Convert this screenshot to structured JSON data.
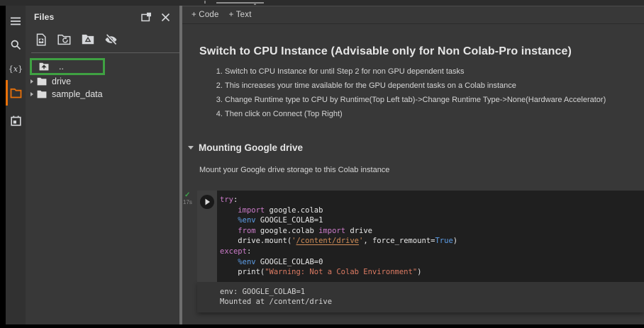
{
  "colors": {
    "accent_orange": "#e8710a",
    "highlight_green": "#3fa142",
    "syntax_keyword": "#cb7bc9",
    "syntax_magic_and_const": "#5d9ee8",
    "syntax_string": "#db7a62",
    "syntax_path_link": "#cf8c57",
    "code_background": "#1f1f1f",
    "page_background": "#383838"
  },
  "rail": {
    "icons": [
      "table-of-contents",
      "search",
      "variables",
      "files",
      "code-snippets"
    ]
  },
  "files_panel": {
    "title": "Files",
    "header_icons": [
      "open-in-new-panel",
      "close"
    ],
    "toolbar_icons": [
      "upload-file",
      "refresh-folder",
      "mount-drive",
      "toggle-hidden-files"
    ],
    "tree": {
      "up_label": "..",
      "items": [
        {
          "label": "drive"
        },
        {
          "label": "sample_data"
        }
      ]
    }
  },
  "notebook_toolbar": {
    "add_code": "+ Code",
    "add_text": "+ Text"
  },
  "markdown": {
    "heading": "Switch to CPU Instance (Advisable only for Non Colab-Pro instance)",
    "list": [
      "Switch to CPU Instance for until Step 2 for non GPU dependent tasks",
      "This increases your time available for the GPU dependent tasks on a Colab instance",
      "Change Runtime type to CPU by Runtime(Top Left tab)->Change Runtime Type->None(Hardware Accelerator)",
      "Then click on Connect (Top Right)"
    ],
    "section_heading": "Mounting Google drive",
    "section_description": "Mount your Google drive storage to this Colab instance"
  },
  "code_cell": {
    "execution_check": "✓",
    "execution_time": "17s",
    "lines": [
      [
        [
          "kw",
          "try"
        ],
        [
          "pl",
          ":"
        ]
      ],
      [
        [
          "pl",
          "    "
        ],
        [
          "kw",
          "import"
        ],
        [
          "pl",
          " google.colab"
        ]
      ],
      [
        [
          "pl",
          "    "
        ],
        [
          "mg",
          "%env"
        ],
        [
          "pl",
          " GOOGLE_COLAB=1"
        ]
      ],
      [
        [
          "pl",
          "    "
        ],
        [
          "kw",
          "from"
        ],
        [
          "pl",
          " google.colab "
        ],
        [
          "kw",
          "import"
        ],
        [
          "pl",
          " drive"
        ]
      ],
      [
        [
          "pl",
          "    drive.mount("
        ],
        [
          "or",
          "'"
        ],
        [
          "lk",
          "/content/drive"
        ],
        [
          "or",
          "'"
        ],
        [
          "pl",
          ", force_remount="
        ],
        [
          "cn",
          "True"
        ],
        [
          "pl",
          ")"
        ]
      ],
      [
        [
          "kw",
          "except"
        ],
        [
          "pl",
          ":"
        ]
      ],
      [
        [
          "pl",
          "    "
        ],
        [
          "mg",
          "%env"
        ],
        [
          "pl",
          " GOOGLE_COLAB=0"
        ]
      ],
      [
        [
          "pl",
          "    print("
        ],
        [
          "st",
          "\"Warning: Not a Colab Environment\""
        ],
        [
          "pl",
          ")"
        ]
      ]
    ],
    "output_lines": [
      "env: GOOGLE_COLAB=1",
      "Mounted at /content/drive"
    ]
  }
}
